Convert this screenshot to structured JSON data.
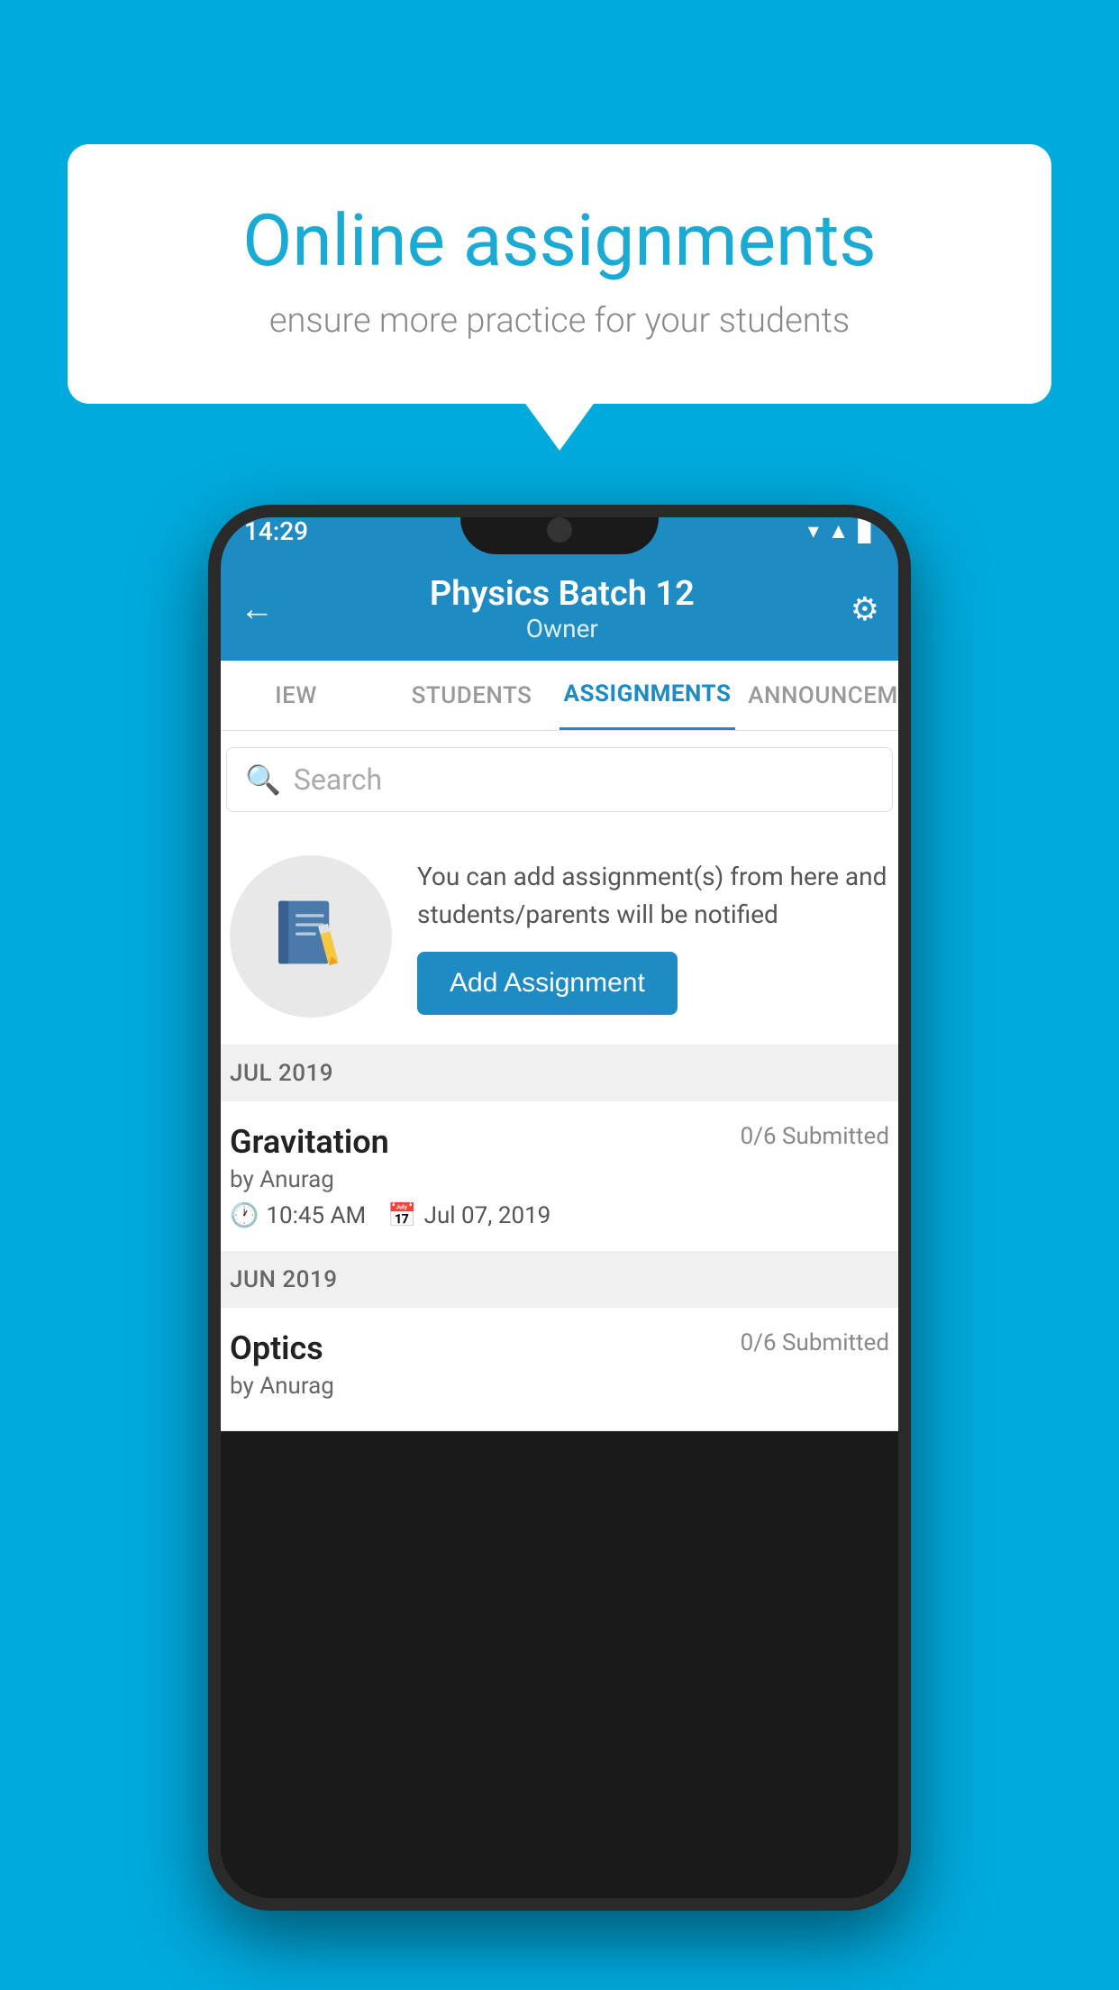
{
  "background_color": "#00AADD",
  "speech_bubble": {
    "title": "Online assignments",
    "subtitle": "ensure more practice for your students"
  },
  "phone": {
    "status_bar": {
      "time": "14:29"
    },
    "app_bar": {
      "title": "Physics Batch 12",
      "subtitle": "Owner",
      "back_label": "←",
      "settings_label": "⚙"
    },
    "tabs": [
      {
        "label": "IEW",
        "active": false
      },
      {
        "label": "STUDENTS",
        "active": false
      },
      {
        "label": "ASSIGNMENTS",
        "active": true
      },
      {
        "label": "ANNOUNCEM",
        "active": false
      }
    ],
    "search": {
      "placeholder": "Search"
    },
    "info_section": {
      "description": "You can add assignment(s) from here and students/parents will be notified",
      "button_label": "Add Assignment"
    },
    "assignments": [
      {
        "section": "JUL 2019",
        "name": "Gravitation",
        "submitted": "0/6 Submitted",
        "by": "by Anurag",
        "time": "10:45 AM",
        "date": "Jul 07, 2019"
      },
      {
        "section": "JUN 2019",
        "name": "Optics",
        "submitted": "0/6 Submitted",
        "by": "by Anurag",
        "time": "",
        "date": ""
      }
    ]
  }
}
